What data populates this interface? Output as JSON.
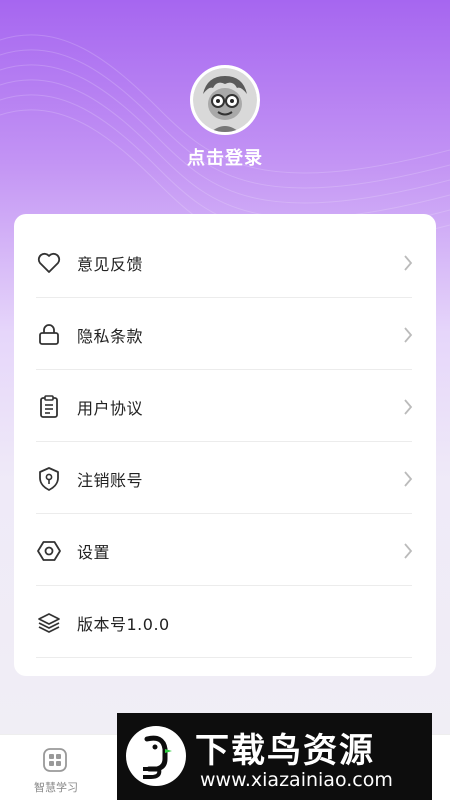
{
  "profile": {
    "login_text": "点击登录"
  },
  "menu": {
    "items": [
      {
        "label": "意见反馈",
        "icon": "heart-icon"
      },
      {
        "label": "隐私条款",
        "icon": "lock-icon"
      },
      {
        "label": "用户协议",
        "icon": "document-icon"
      },
      {
        "label": "注销账号",
        "icon": "shield-key-icon"
      },
      {
        "label": "设置",
        "icon": "hexagon-settings-icon"
      },
      {
        "label": "版本号1.0.0",
        "icon": "layers-icon"
      }
    ]
  },
  "tabbar": {
    "tabs": [
      {
        "label": "智慧学习",
        "icon": "grid-icon"
      }
    ]
  },
  "watermark": {
    "title": "下载鸟资源",
    "url": "www.xiazainiao.com"
  },
  "colors": {
    "gradient_top": "#a666f0",
    "card_bg": "#ffffff",
    "text_primary": "#222222"
  }
}
